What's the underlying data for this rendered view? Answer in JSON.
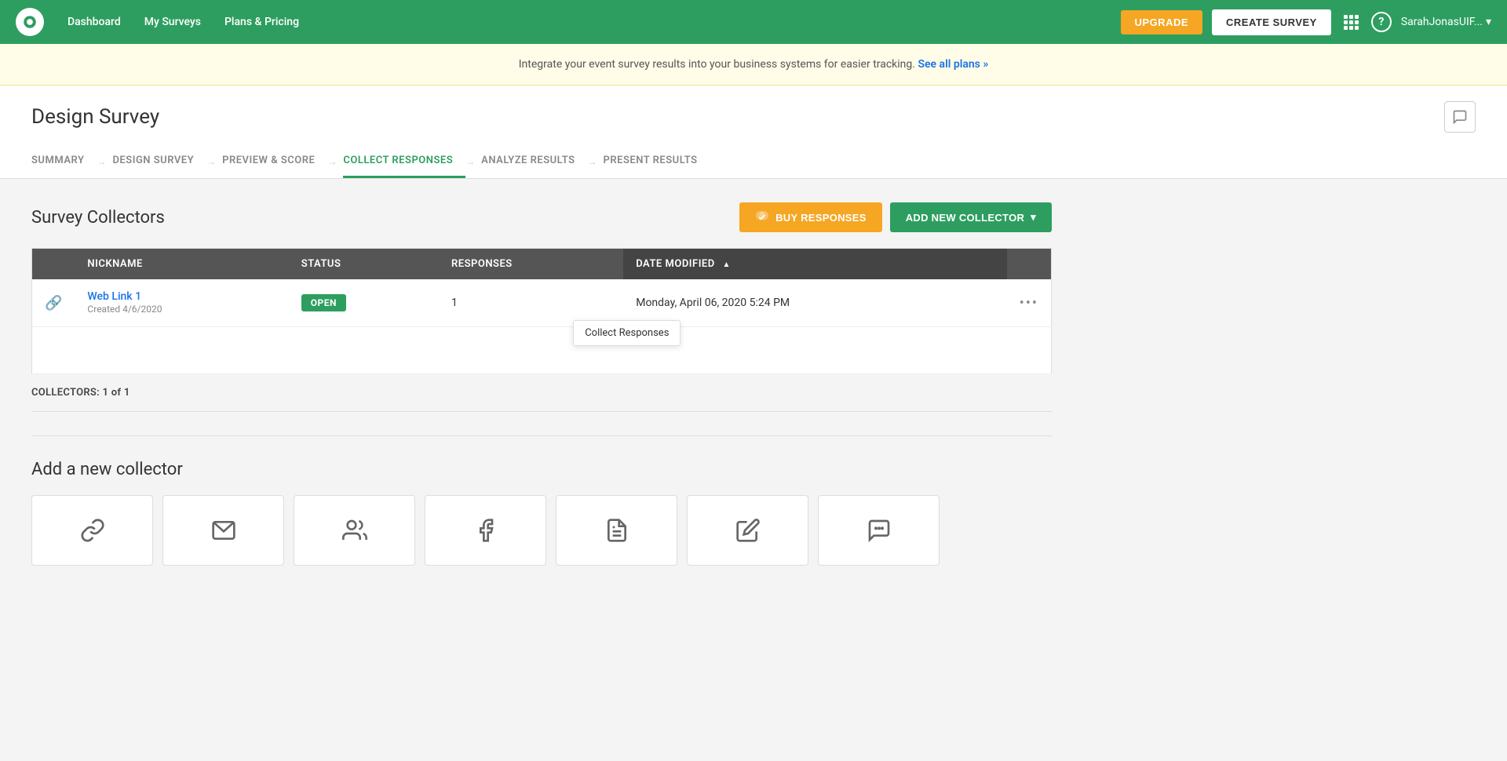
{
  "topnav": {
    "dashboard": "Dashboard",
    "my_surveys": "My Surveys",
    "plans_pricing": "Plans & Pricing",
    "upgrade_label": "UPGRADE",
    "create_survey_label": "CREATE SURVEY",
    "user_name": "SarahJonasUIF...",
    "help_icon": "?",
    "grid_icon": "⊞"
  },
  "banner": {
    "text": "Integrate your event survey results into your business systems for easier tracking.",
    "link_text": "See all plans »"
  },
  "page": {
    "title": "Design Survey"
  },
  "steps": [
    {
      "id": "summary",
      "label": "SUMMARY",
      "active": false
    },
    {
      "id": "design",
      "label": "DESIGN SURVEY",
      "active": false
    },
    {
      "id": "preview",
      "label": "PREVIEW & SCORE",
      "active": false
    },
    {
      "id": "collect",
      "label": "COLLECT RESPONSES",
      "active": true
    },
    {
      "id": "analyze",
      "label": "ANALYZE RESULTS",
      "active": false
    },
    {
      "id": "present",
      "label": "PRESENT RESULTS",
      "active": false
    }
  ],
  "collectors": {
    "section_title": "Survey Collectors",
    "buy_responses_label": "BUY RESPONSES",
    "add_collector_label": "ADD NEW COLLECTOR",
    "table": {
      "columns": {
        "nickname": "NICKNAME",
        "status": "STATUS",
        "responses": "RESPONSES",
        "date_modified": "DATE MODIFIED"
      },
      "rows": [
        {
          "name": "Web Link 1",
          "created": "Created 4/6/2020",
          "status": "OPEN",
          "responses": "1",
          "date_modified": "Monday, April 06, 2020 5:24 PM"
        }
      ]
    },
    "count_label": "COLLECTORS:",
    "count_value": "1 of 1",
    "tooltip_text": "Collect Responses"
  },
  "add_collector": {
    "title": "Add a new collector",
    "cards": [
      {
        "id": "web-link",
        "icon": "🔗"
      },
      {
        "id": "email",
        "icon": "✉"
      },
      {
        "id": "group",
        "icon": "👥"
      },
      {
        "id": "facebook",
        "icon": "f"
      },
      {
        "id": "document",
        "icon": "📋"
      },
      {
        "id": "edit",
        "icon": "✏"
      },
      {
        "id": "messenger",
        "icon": "💬"
      }
    ]
  }
}
